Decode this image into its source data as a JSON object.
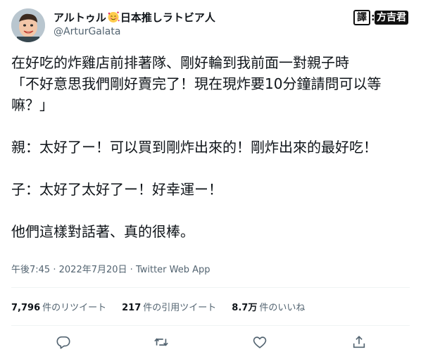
{
  "user": {
    "display_name_part1": "アルトゥル",
    "emoji": "smiling-face-with-hearts",
    "display_name_part2": "日本推しラトビア人",
    "handle": "@ArturGalata"
  },
  "translator_badge": {
    "label1": "譯",
    "separator": ":",
    "label2": "方吉君"
  },
  "tweet": {
    "text": "在好吃的炸雞店前排著隊、剛好輪到我前面一對親子時\n「不好意思我們剛好賣完了！現在現炸要10分鐘請問可以等嘛？」\n\n親：太好了ー！可以買到剛炸出來的！剛炸出來的最好吃！\n\n子：太好了太好了ー！好幸運ー！\n\n他們這樣對話著、真的很棒。",
    "time": "午後7:45",
    "dot1": "·",
    "date": "2022年7月20日",
    "dot2": "·",
    "source": "Twitter Web App"
  },
  "stats": {
    "retweets_count": "7,796",
    "retweets_label": "件のリツイート",
    "quotes_count": "217",
    "quotes_label": "件の引用ツイート",
    "likes_count": "8.7万",
    "likes_label": "件のいいね"
  },
  "actions": [
    "reply-icon",
    "retweet-icon",
    "like-icon",
    "share-icon"
  ],
  "colors": {
    "text": "#0f1419",
    "secondary": "#536471",
    "divider": "#eff3f4"
  }
}
